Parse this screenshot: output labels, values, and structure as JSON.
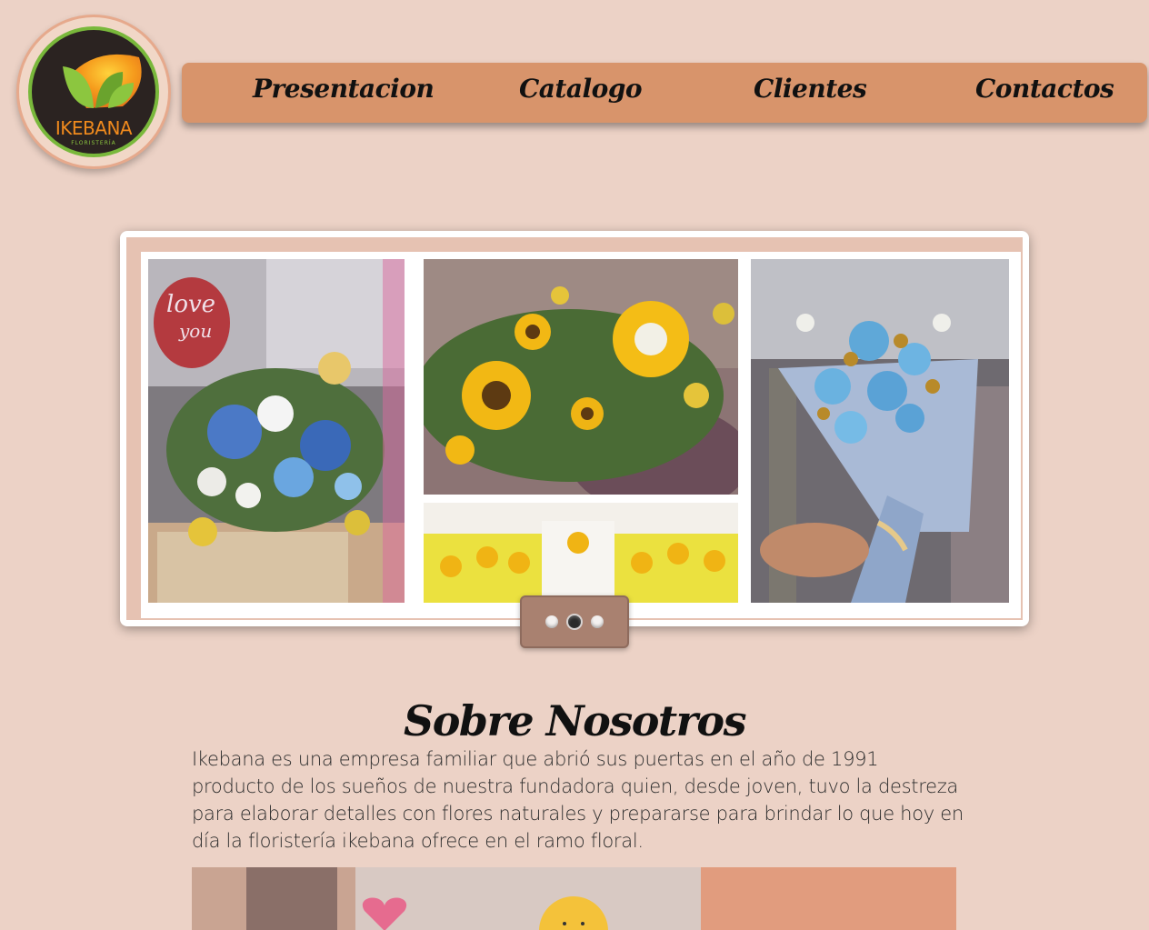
{
  "brand": {
    "logo_name": "IKEBANA",
    "logo_sub": "FLORISTERÍA"
  },
  "nav": {
    "items": [
      {
        "label": "Presentacion"
      },
      {
        "label": "Catalogo"
      },
      {
        "label": "Clientes"
      },
      {
        "label": "Contactos"
      }
    ]
  },
  "slider": {
    "photos": [
      {
        "description_icon": "blue-flower-arrangement-photo"
      },
      {
        "description_icon": "sunflower-arrangement-photo"
      },
      {
        "description_icon": "bridesmaids-sunflower-bouquets-photo"
      },
      {
        "description_icon": "blue-rose-bouquet-photo"
      }
    ],
    "dot_count": 3,
    "active_dot": 2
  },
  "about": {
    "title": "Sobre Nosotros",
    "body": "Ikebana es una empresa familiar que abrió sus puertas en el año de 1991 producto de los sueños de nuestra fundadora quien, desde joven, tuvo la destreza para elaborar detalles con flores naturales y prepararse para brindar lo que hoy en día la floristería ikebana ofrece en el ramo floral."
  },
  "colors": {
    "page_bg": "#ecd2c6",
    "nav_bg": "#d8946b",
    "logo_orange": "#f08a1d",
    "logo_green": "#79b83b",
    "dots_bg": "#a98170"
  }
}
